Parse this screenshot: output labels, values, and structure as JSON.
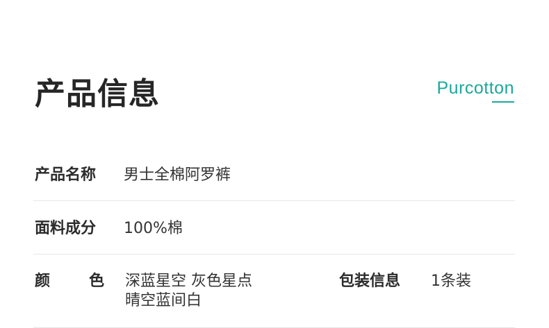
{
  "header": {
    "title": "产品信息",
    "brand": "Purcotton",
    "accent_color": "#1aa89a"
  },
  "specs": {
    "product_name": {
      "label": "产品名称",
      "value": "男士全棉阿罗裤"
    },
    "material": {
      "label": "面料成分",
      "value": "100%棉"
    },
    "color": {
      "label_char_1": "颜",
      "label_char_2": "色",
      "values": [
        "深蓝星空 灰色星点",
        "晴空蓝间白"
      ]
    },
    "packaging": {
      "label": "包装信息",
      "value": "1条装"
    }
  }
}
